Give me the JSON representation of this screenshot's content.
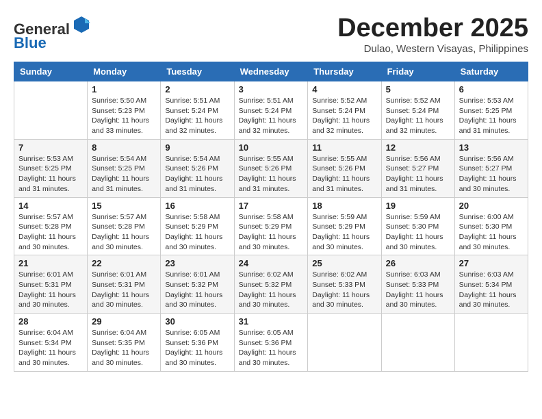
{
  "header": {
    "logo_general": "General",
    "logo_blue": "Blue",
    "month_title": "December 2025",
    "location": "Dulao, Western Visayas, Philippines"
  },
  "days_of_week": [
    "Sunday",
    "Monday",
    "Tuesday",
    "Wednesday",
    "Thursday",
    "Friday",
    "Saturday"
  ],
  "weeks": [
    [
      {
        "day": "",
        "info": ""
      },
      {
        "day": "1",
        "info": "Sunrise: 5:50 AM\nSunset: 5:23 PM\nDaylight: 11 hours\nand 33 minutes."
      },
      {
        "day": "2",
        "info": "Sunrise: 5:51 AM\nSunset: 5:24 PM\nDaylight: 11 hours\nand 32 minutes."
      },
      {
        "day": "3",
        "info": "Sunrise: 5:51 AM\nSunset: 5:24 PM\nDaylight: 11 hours\nand 32 minutes."
      },
      {
        "day": "4",
        "info": "Sunrise: 5:52 AM\nSunset: 5:24 PM\nDaylight: 11 hours\nand 32 minutes."
      },
      {
        "day": "5",
        "info": "Sunrise: 5:52 AM\nSunset: 5:24 PM\nDaylight: 11 hours\nand 32 minutes."
      },
      {
        "day": "6",
        "info": "Sunrise: 5:53 AM\nSunset: 5:25 PM\nDaylight: 11 hours\nand 31 minutes."
      }
    ],
    [
      {
        "day": "7",
        "info": "Sunrise: 5:53 AM\nSunset: 5:25 PM\nDaylight: 11 hours\nand 31 minutes."
      },
      {
        "day": "8",
        "info": "Sunrise: 5:54 AM\nSunset: 5:25 PM\nDaylight: 11 hours\nand 31 minutes."
      },
      {
        "day": "9",
        "info": "Sunrise: 5:54 AM\nSunset: 5:26 PM\nDaylight: 11 hours\nand 31 minutes."
      },
      {
        "day": "10",
        "info": "Sunrise: 5:55 AM\nSunset: 5:26 PM\nDaylight: 11 hours\nand 31 minutes."
      },
      {
        "day": "11",
        "info": "Sunrise: 5:55 AM\nSunset: 5:26 PM\nDaylight: 11 hours\nand 31 minutes."
      },
      {
        "day": "12",
        "info": "Sunrise: 5:56 AM\nSunset: 5:27 PM\nDaylight: 11 hours\nand 31 minutes."
      },
      {
        "day": "13",
        "info": "Sunrise: 5:56 AM\nSunset: 5:27 PM\nDaylight: 11 hours\nand 30 minutes."
      }
    ],
    [
      {
        "day": "14",
        "info": "Sunrise: 5:57 AM\nSunset: 5:28 PM\nDaylight: 11 hours\nand 30 minutes."
      },
      {
        "day": "15",
        "info": "Sunrise: 5:57 AM\nSunset: 5:28 PM\nDaylight: 11 hours\nand 30 minutes."
      },
      {
        "day": "16",
        "info": "Sunrise: 5:58 AM\nSunset: 5:29 PM\nDaylight: 11 hours\nand 30 minutes."
      },
      {
        "day": "17",
        "info": "Sunrise: 5:58 AM\nSunset: 5:29 PM\nDaylight: 11 hours\nand 30 minutes."
      },
      {
        "day": "18",
        "info": "Sunrise: 5:59 AM\nSunset: 5:29 PM\nDaylight: 11 hours\nand 30 minutes."
      },
      {
        "day": "19",
        "info": "Sunrise: 5:59 AM\nSunset: 5:30 PM\nDaylight: 11 hours\nand 30 minutes."
      },
      {
        "day": "20",
        "info": "Sunrise: 6:00 AM\nSunset: 5:30 PM\nDaylight: 11 hours\nand 30 minutes."
      }
    ],
    [
      {
        "day": "21",
        "info": "Sunrise: 6:01 AM\nSunset: 5:31 PM\nDaylight: 11 hours\nand 30 minutes."
      },
      {
        "day": "22",
        "info": "Sunrise: 6:01 AM\nSunset: 5:31 PM\nDaylight: 11 hours\nand 30 minutes."
      },
      {
        "day": "23",
        "info": "Sunrise: 6:01 AM\nSunset: 5:32 PM\nDaylight: 11 hours\nand 30 minutes."
      },
      {
        "day": "24",
        "info": "Sunrise: 6:02 AM\nSunset: 5:32 PM\nDaylight: 11 hours\nand 30 minutes."
      },
      {
        "day": "25",
        "info": "Sunrise: 6:02 AM\nSunset: 5:33 PM\nDaylight: 11 hours\nand 30 minutes."
      },
      {
        "day": "26",
        "info": "Sunrise: 6:03 AM\nSunset: 5:33 PM\nDaylight: 11 hours\nand 30 minutes."
      },
      {
        "day": "27",
        "info": "Sunrise: 6:03 AM\nSunset: 5:34 PM\nDaylight: 11 hours\nand 30 minutes."
      }
    ],
    [
      {
        "day": "28",
        "info": "Sunrise: 6:04 AM\nSunset: 5:34 PM\nDaylight: 11 hours\nand 30 minutes."
      },
      {
        "day": "29",
        "info": "Sunrise: 6:04 AM\nSunset: 5:35 PM\nDaylight: 11 hours\nand 30 minutes."
      },
      {
        "day": "30",
        "info": "Sunrise: 6:05 AM\nSunset: 5:36 PM\nDaylight: 11 hours\nand 30 minutes."
      },
      {
        "day": "31",
        "info": "Sunrise: 6:05 AM\nSunset: 5:36 PM\nDaylight: 11 hours\nand 30 minutes."
      },
      {
        "day": "",
        "info": ""
      },
      {
        "day": "",
        "info": ""
      },
      {
        "day": "",
        "info": ""
      }
    ]
  ]
}
